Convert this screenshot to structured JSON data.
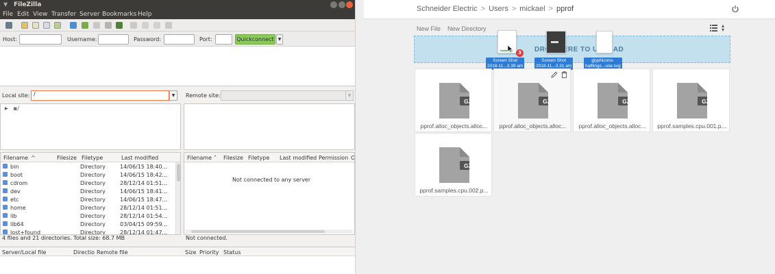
{
  "filezilla": {
    "title": "FileZilla",
    "menu": [
      "File",
      "Edit",
      "View",
      "Transfer",
      "Server",
      "Bookmarks",
      "Help"
    ],
    "quickconnect": {
      "host_label": "Host:",
      "username_label": "Username:",
      "password_label": "Password:",
      "port_label": "Port:",
      "button_label": "Quickconnect"
    },
    "local_site_label": "Local site:",
    "local_site_value": "/",
    "remote_site_label": "Remote site:",
    "local_columns": {
      "filename": "Filename",
      "filesize": "Filesize",
      "filetype": "Filetype",
      "last_modified": "Last modified"
    },
    "remote_columns": {
      "filename": "Filename",
      "filesize": "Filesize",
      "filetype": "Filetype",
      "last_modified": "Last modified",
      "permission": "Permission",
      "owner": "O"
    },
    "local_files": [
      {
        "name": "bin",
        "type": "Directory",
        "modified": "14/06/15 18:40..."
      },
      {
        "name": "boot",
        "type": "Directory",
        "modified": "14/06/15 18:42..."
      },
      {
        "name": "cdrom",
        "type": "Directory",
        "modified": "28/12/14 01:51..."
      },
      {
        "name": "dev",
        "type": "Directory",
        "modified": "14/06/15 18:41..."
      },
      {
        "name": "etc",
        "type": "Directory",
        "modified": "14/06/15 18:47..."
      },
      {
        "name": "home",
        "type": "Directory",
        "modified": "28/12/14 01:51..."
      },
      {
        "name": "lib",
        "type": "Directory",
        "modified": "28/12/14 01:54..."
      },
      {
        "name": "lib64",
        "type": "Directory",
        "modified": "03/04/15 09:59..."
      },
      {
        "name": "lost+found",
        "type": "Directory",
        "modified": "28/12/14 01:47..."
      }
    ],
    "remote_empty_message": "Not connected to any server",
    "local_status": "4 files and 21 directories. Total size: 68.7 MB",
    "remote_status": "Not connected.",
    "queue_columns": {
      "server_local": "Server/Local file",
      "direction": "Directio",
      "remote": "Remote file",
      "size": "Size",
      "priority": "Priority",
      "status": "Status"
    }
  },
  "web": {
    "breadcrumb": [
      "Schneider Electric",
      "Users",
      "mickael",
      "pprof"
    ],
    "actions": {
      "new_file": "New File",
      "new_directory": "New Directory"
    },
    "dropzone_text": "DROP HERE TO UPLOAD",
    "drag_count": "3",
    "dragging": [
      {
        "line1": "Screen Shot",
        "line2": "2018-11...3.39 am"
      },
      {
        "line1": "Screen Shot",
        "line2": "2018-11...3.31 am"
      },
      {
        "line1": "glyphicons-",
        "line2": "halflings...ular.svg"
      }
    ],
    "file_badge": "GZ",
    "files": [
      "pprof.alloc_objects.alloc...",
      "pprof.alloc_objects.alloc...",
      "pprof.alloc_objects.alloc...",
      "pprof.samples.cpu.001.p...",
      "pprof.samples.cpu.002.p..."
    ]
  }
}
